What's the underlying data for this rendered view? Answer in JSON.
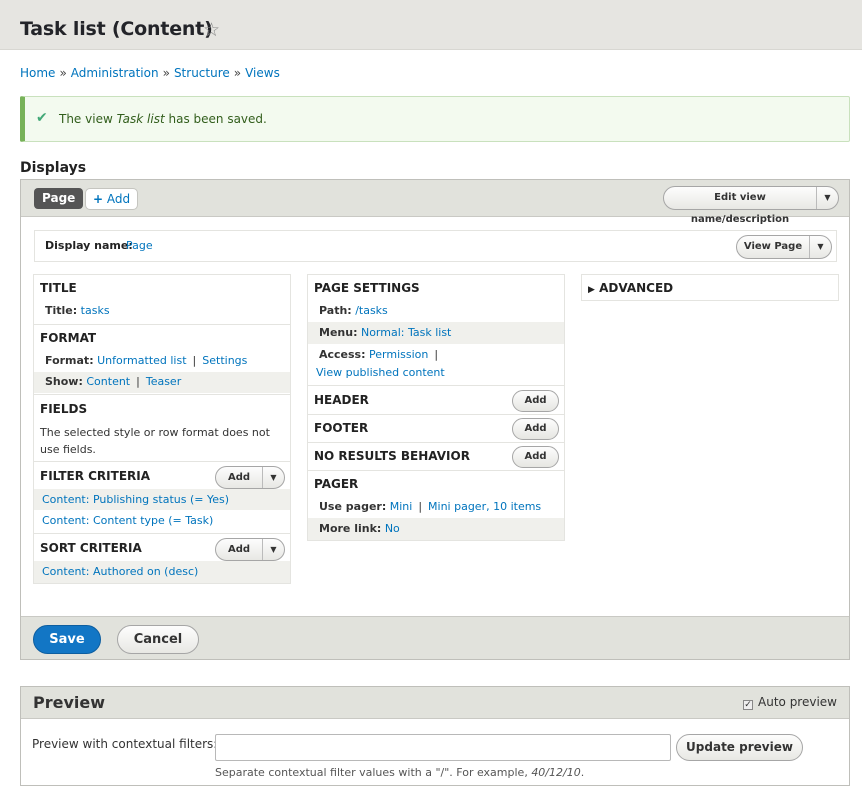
{
  "page": {
    "title": "Task list (Content)",
    "breadcrumb": [
      "Home",
      "Administration",
      "Structure",
      "Views"
    ],
    "breadcrumb_sep": "»"
  },
  "status": {
    "prefix": "The view",
    "view_name": "Task list",
    "suffix": "has been saved."
  },
  "displays": {
    "heading": "Displays",
    "tab_page": "Page",
    "add_label": "Add",
    "edit_view_label": "Edit view name/description",
    "display_name_label": "Display name:",
    "display_name_value": "Page",
    "view_page_label": "View Page"
  },
  "left": {
    "title_section": "TITLE",
    "title_label": "Title:",
    "title_value": "tasks",
    "format_section": "FORMAT",
    "format_label": "Format:",
    "format_value": "Unformatted list",
    "format_settings": "Settings",
    "show_label": "Show:",
    "show_value": "Content",
    "show_mode": "Teaser",
    "fields_section": "FIELDS",
    "fields_note": "The selected style or row format does not use fields.",
    "filter_section": "FILTER CRITERIA",
    "filter_add": "Add",
    "filters": [
      "Content: Publishing status (= Yes)",
      "Content: Content type (= Task)"
    ],
    "sort_section": "SORT CRITERIA",
    "sort_add": "Add",
    "sorts": [
      "Content: Authored on (desc)"
    ]
  },
  "middle": {
    "page_settings": "PAGE SETTINGS",
    "path_label": "Path:",
    "path_value": "/tasks",
    "menu_label": "Menu:",
    "menu_value": "Normal: Task list",
    "access_label": "Access:",
    "access_value": "Permission",
    "access_detail": "View published content",
    "header_section": "HEADER",
    "footer_section": "FOOTER",
    "no_results_section": "NO RESULTS BEHAVIOR",
    "add_label": "Add",
    "pager_section": "PAGER",
    "use_pager_label": "Use pager:",
    "use_pager_value": "Mini",
    "use_pager_detail": "Mini pager, 10 items",
    "more_link_label": "More link:",
    "more_link_value": "No"
  },
  "right": {
    "advanced": "ADVANCED"
  },
  "actions": {
    "save": "Save",
    "cancel": "Cancel"
  },
  "preview": {
    "title": "Preview",
    "auto_preview": "Auto preview",
    "auto_preview_checked": true,
    "contextual_label": "Preview with contextual filters:",
    "contextual_value": "",
    "update_button": "Update preview",
    "help_prefix": "Separate contextual filter values with a \"/\". For example,",
    "help_example": "40/12/10",
    "help_suffix": "."
  },
  "colors": {
    "link": "#0074bd",
    "primary_button": "#1276c5",
    "status_border": "#77b259",
    "status_bg": "#f3faef",
    "header_bg": "#e6e5e1"
  }
}
